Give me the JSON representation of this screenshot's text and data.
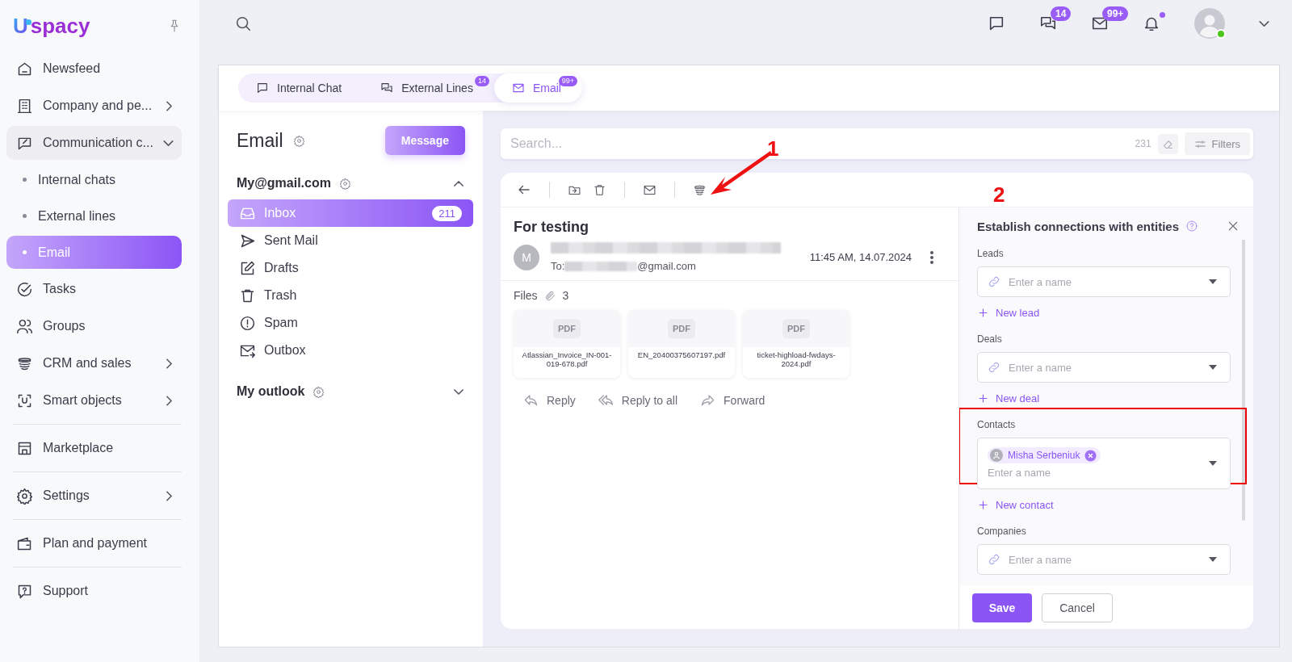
{
  "sidebar": {
    "logo": {
      "mark": "U",
      "text": "spacy"
    },
    "items": [
      {
        "label": "Newsfeed",
        "selected": false
      },
      {
        "label": "Company and pe...",
        "selected": false,
        "expanded": false
      },
      {
        "label": "Communication c...",
        "selected": false,
        "expanded": true,
        "children": [
          {
            "label": "Internal chats",
            "selected": false
          },
          {
            "label": "External lines",
            "selected": false
          },
          {
            "label": "Email",
            "selected": true
          }
        ]
      },
      {
        "label": "Tasks",
        "selected": false
      },
      {
        "label": "Groups",
        "selected": false
      },
      {
        "label": "CRM and sales",
        "selected": false,
        "expanded": false
      },
      {
        "label": "Smart objects",
        "selected": false,
        "expanded": false
      },
      {
        "label": "Marketplace",
        "selected": false,
        "divider_before": true
      },
      {
        "label": "Settings",
        "selected": false,
        "expanded": false,
        "divider_before": true
      },
      {
        "label": "Plan and payment",
        "selected": false,
        "divider_before": true
      },
      {
        "label": "Support",
        "selected": false,
        "divider_before": true
      }
    ]
  },
  "top_bar": {
    "chats_badge": "14",
    "mail_badge": "99+",
    "notifications_unread": true,
    "user_online": true
  },
  "tabs": [
    {
      "label": "Internal Chat",
      "selected": false
    },
    {
      "label": "External Lines",
      "badge": "14",
      "selected": false
    },
    {
      "label": "Email",
      "badge": "99+",
      "selected": true
    }
  ],
  "email_panel": {
    "title": "Email",
    "compose_button": "Message",
    "accounts": [
      {
        "name": "My@gmail.com",
        "expanded": true,
        "folders": [
          {
            "label": "Inbox",
            "count": "211",
            "selected": true
          },
          {
            "label": "Sent Mail",
            "selected": false
          },
          {
            "label": "Drafts",
            "selected": false
          },
          {
            "label": "Trash",
            "selected": false
          },
          {
            "label": "Spam",
            "selected": false
          },
          {
            "label": "Outbox",
            "selected": false
          }
        ]
      },
      {
        "name": "My outlook",
        "expanded": false
      }
    ]
  },
  "search": {
    "placeholder": "Search...",
    "count": "231",
    "filters_button": "Filters"
  },
  "message": {
    "subject": "For testing",
    "avatar_letter": "M",
    "time": "11:45 AM, 14.07.2024",
    "to_label": "To:",
    "to_suffix": "@gmail.com",
    "files_label": "Files",
    "files_count": "3",
    "files": [
      {
        "type": "PDF",
        "name": "Atlassian_Invoice_IN-001-019-678.pdf"
      },
      {
        "type": "PDF",
        "name": "EN_20400375607197.pdf"
      },
      {
        "type": "PDF",
        "name": "ticket-highload-fwdays-2024.pdf"
      }
    ],
    "actions": [
      "Reply",
      "Reply to all",
      "Forward"
    ]
  },
  "connections": {
    "title": "Establish connections with entities",
    "sections": [
      {
        "label": "Leads",
        "placeholder": "Enter a name",
        "add_link": "New lead"
      },
      {
        "label": "Deals",
        "placeholder": "Enter a name",
        "add_link": "New deal"
      },
      {
        "label": "Contacts",
        "placeholder": "Enter a name",
        "chips": [
          "Misha Serbeniuk"
        ],
        "add_link": "New contact",
        "highlighted": true
      },
      {
        "label": "Companies",
        "placeholder": "Enter a name"
      }
    ],
    "save_button": "Save",
    "cancel_button": "Cancel"
  },
  "annotations": [
    {
      "label": "1"
    },
    {
      "label": "2"
    }
  ]
}
